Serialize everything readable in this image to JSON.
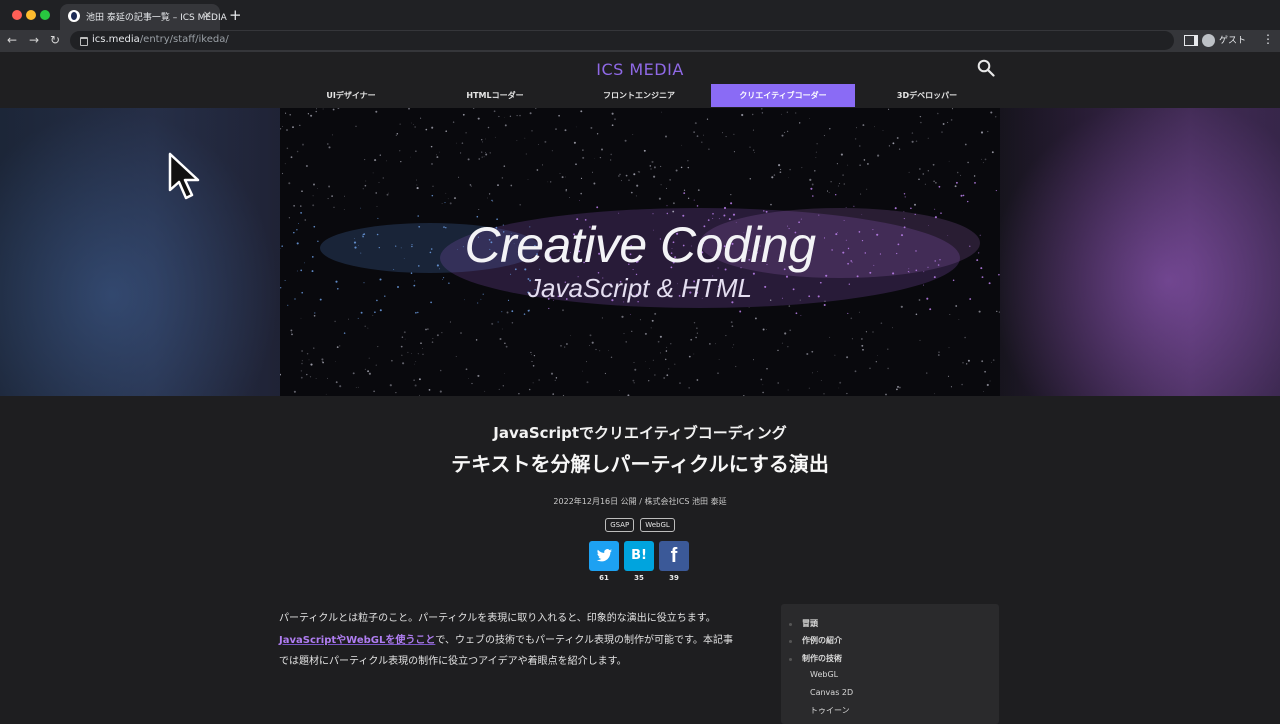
{
  "browser": {
    "tab_title": "池田 泰延の記事一覧 – ICS MEDIA",
    "tab_close": "×",
    "new_tab": "+",
    "url_host": "ics.media",
    "url_path": "/entry/staff/ikeda/",
    "profile_label": "ゲスト",
    "back": "←",
    "forward": "→",
    "reload": "↻",
    "menu": "⋮"
  },
  "site": {
    "logo": "ICS MEDIA",
    "nav": [
      {
        "label": "UIデザイナー"
      },
      {
        "label": "HTMLコーダー"
      },
      {
        "label": "フロントエンジニア"
      },
      {
        "label": "クリエイティブコーダー",
        "active": true
      },
      {
        "label": "3Dデベロッパー"
      }
    ]
  },
  "hero": {
    "title": "Creative Coding",
    "subtitle": "JavaScript & HTML"
  },
  "article": {
    "subtitle": "JavaScriptでクリエイティブコーディング",
    "title": "テキストを分解しパーティクルにする演出",
    "meta": "2022年12月16日 公開 / 株式会社ICS 池田 泰延",
    "tags": [
      "GSAP",
      "WebGL"
    ],
    "shares": [
      {
        "service": "twitter",
        "glyph": "twitter-bird-icon",
        "count": "61",
        "color": "#1da1f2"
      },
      {
        "service": "hatena",
        "glyph": "B!",
        "count": "35",
        "color": "#00a4de"
      },
      {
        "service": "facebook",
        "glyph": "f",
        "count": "39",
        "color": "#3b5998"
      }
    ],
    "body_line1": "パーティクルとは粒子のこと。パーティクルを表現に取り入れると、印象的な演出に役立ちます。",
    "body_link": "JavaScriptやWebGLを使うこと",
    "body_line2_rest": "で、ウェブの技術でもパーティクル表現の制作が可能です。本記事",
    "body_line3": "では題材にパーティクル表現の制作に役立つアイデアや着眼点を紹介します。"
  },
  "toc": {
    "items": [
      {
        "label": "冒頭",
        "level": 1
      },
      {
        "label": "作例の紹介",
        "level": 1
      },
      {
        "label": "制作の技術",
        "level": 1
      },
      {
        "label": "WebGL",
        "level": 2
      },
      {
        "label": "Canvas 2D",
        "level": 2
      },
      {
        "label": "トゥイーン",
        "level": 2
      }
    ]
  },
  "colors": {
    "accent": "#8a6bf5",
    "logo": "#8f69e6",
    "link": "#b07ef2"
  }
}
